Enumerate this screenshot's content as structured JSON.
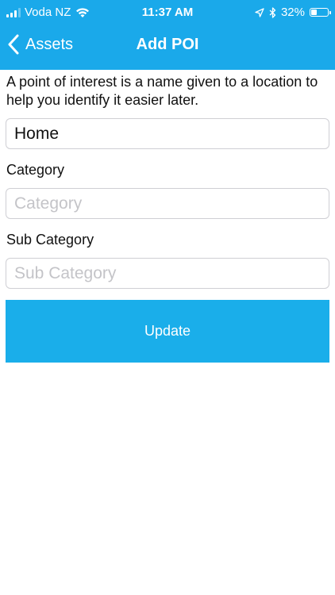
{
  "status_bar": {
    "carrier": "Voda NZ",
    "time": "11:37 AM",
    "battery": "32%"
  },
  "nav": {
    "back_label": "Assets",
    "title": "Add POI"
  },
  "intro_text": "A point of interest is a name given to a location to help you identify it easier later.",
  "name_field": {
    "value": "Home"
  },
  "category": {
    "label": "Category",
    "placeholder": "Category"
  },
  "sub_category": {
    "label": "Sub Category",
    "placeholder": "Sub Category"
  },
  "update_button": {
    "label": "Update"
  },
  "colors": {
    "accent": "#1aa9ea",
    "button": "#1aaeea"
  }
}
